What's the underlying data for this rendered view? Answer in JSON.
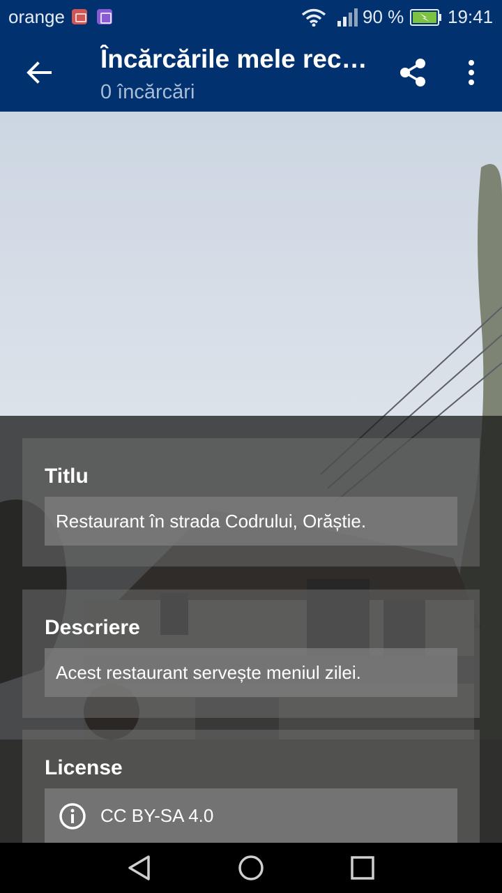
{
  "status_bar": {
    "carrier": "orange",
    "battery_percent": "90 %",
    "time": "19:41",
    "icons": [
      "mail-notification-icon",
      "photo-notification-icon",
      "wifi-icon",
      "signal-icon",
      "battery-charging-icon"
    ]
  },
  "app_bar": {
    "title": "Încărcările mele recente",
    "subtitle": "0 încărcări",
    "color": "#023170",
    "icons": [
      "back-arrow-icon",
      "share-icon",
      "more-vert-icon"
    ]
  },
  "details": {
    "title_label": "Titlu",
    "title_value": "Restaurant în strada Codrului, Orăștie.",
    "description_label": "Descriere",
    "description_value": "Acest restaurant servește meniul zilei.",
    "license_label": "License",
    "license_value": "CC BY-SA 4.0",
    "license_icon": "info-icon"
  },
  "nav_bar": {
    "icons": [
      "nav-back-icon",
      "nav-home-icon",
      "nav-recents-icon"
    ]
  }
}
